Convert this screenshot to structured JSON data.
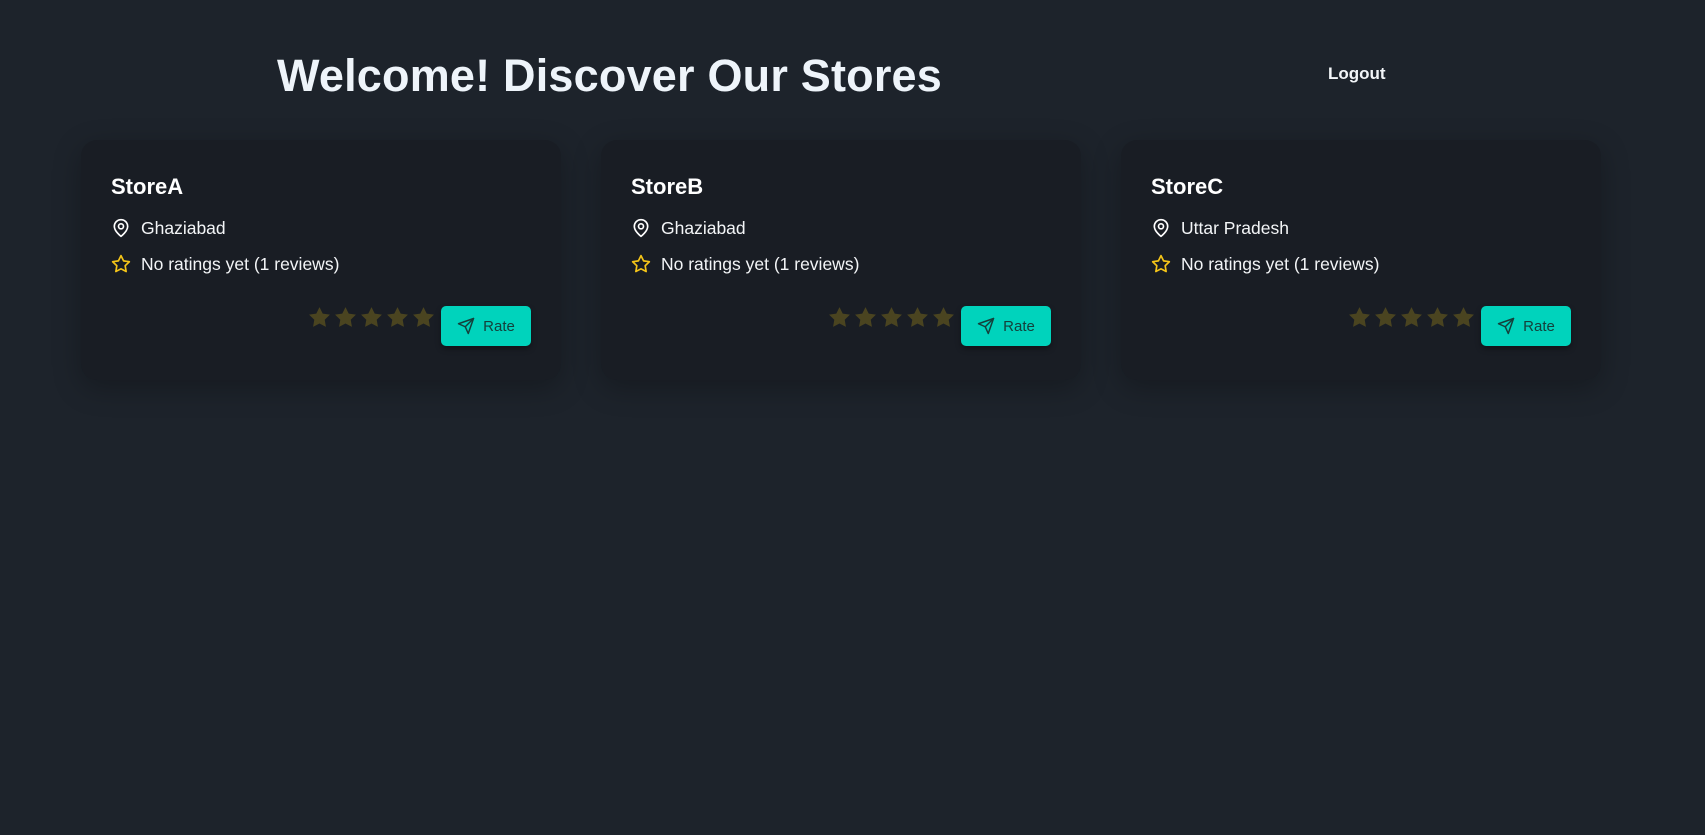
{
  "header": {
    "title": "Welcome! Discover Our Stores",
    "logout_label": "Logout"
  },
  "colors": {
    "background": "#1d232b",
    "card": "#191d24",
    "accent": "#00d3bc",
    "rating_star": "#f5c518",
    "empty_star": "#4a4420"
  },
  "stores": [
    {
      "name": "StoreA",
      "location": "Ghaziabad",
      "rating_text": "No ratings yet (1 reviews)",
      "stars_selected": 0,
      "rate_label": "Rate"
    },
    {
      "name": "StoreB",
      "location": "Ghaziabad",
      "rating_text": "No ratings yet (1 reviews)",
      "stars_selected": 0,
      "rate_label": "Rate"
    },
    {
      "name": "StoreC",
      "location": "Uttar Pradesh",
      "rating_text": "No ratings yet (1 reviews)",
      "stars_selected": 0,
      "rate_label": "Rate"
    }
  ]
}
